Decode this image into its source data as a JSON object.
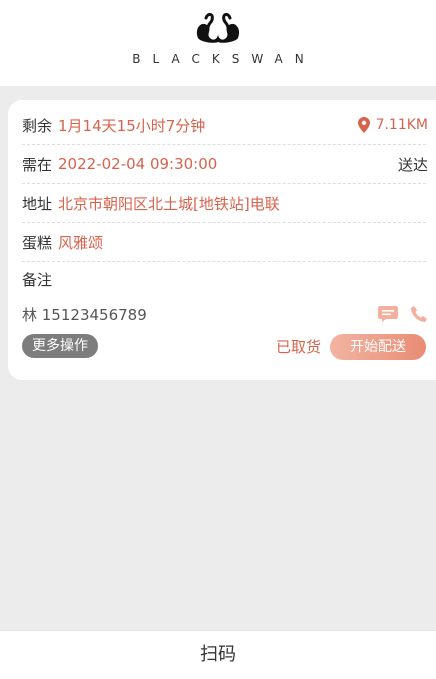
{
  "header": {
    "brand": "BLACKSWAN",
    "logo_icon": "swan-logo-icon"
  },
  "order": {
    "remaining": {
      "label": "剩余",
      "value": "1月14天15小时7分钟"
    },
    "distance": {
      "icon": "location-pin-icon",
      "value": "7.11KM"
    },
    "required": {
      "label": "需在",
      "value": "2022-02-04 09:30:00",
      "suffix": "送达"
    },
    "address": {
      "label": "地址",
      "value": "北京市朝阳区北土城[地铁站]电联"
    },
    "cake": {
      "label": "蛋糕",
      "value": "风雅颂"
    },
    "note": {
      "label": "备注"
    },
    "contact": {
      "name_phone": "林 15123456789",
      "message_icon": "message-icon",
      "phone_icon": "phone-icon"
    },
    "actions": {
      "more": "更多操作",
      "picked_up": "已取货",
      "start": "开始配送"
    }
  },
  "footer": {
    "scan": "扫码"
  },
  "colors": {
    "accent": "#d8634d",
    "button_gray": "#7d7d7d",
    "background": "#ececec"
  }
}
